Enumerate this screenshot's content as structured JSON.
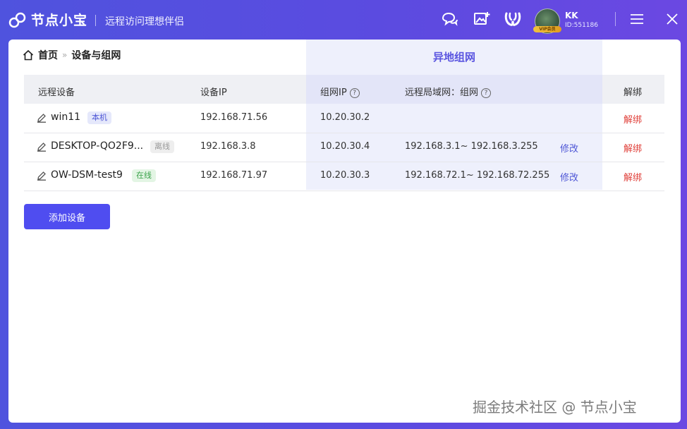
{
  "app": {
    "brand": "节点小宝",
    "slogan": "远程访问理想伴侣"
  },
  "user": {
    "name": "KK",
    "id": "ID:551186",
    "vip_label": "VIP会员"
  },
  "breadcrumb": {
    "home": "首页",
    "current": "设备与组网"
  },
  "group_header": "异地组网",
  "table": {
    "columns": [
      "远程设备",
      "设备IP",
      "组网IP",
      "远程局域网：组网",
      "解绑"
    ],
    "rows": [
      {
        "name": "win11",
        "badge": "本机",
        "badge_type": "local",
        "device_ip": "192.168.71.56",
        "group_ip": "10.20.30.2",
        "lan": "",
        "edit": "",
        "unbind": "解绑"
      },
      {
        "name": "DESKTOP-QO2F9...",
        "badge": "离线",
        "badge_type": "offline",
        "device_ip": "192.168.3.8",
        "group_ip": "10.20.30.4",
        "lan": "192.168.3.1~ 192.168.3.255",
        "edit": "修改",
        "unbind": "解绑"
      },
      {
        "name": "OW-DSM-test9",
        "badge": "在线",
        "badge_type": "online",
        "device_ip": "192.168.71.97",
        "group_ip": "10.20.30.3",
        "lan": "192.168.72.1~ 192.168.72.255",
        "edit": "修改",
        "unbind": "解绑"
      }
    ]
  },
  "add_device_label": "添加设备",
  "watermark": "掘金技术社区 @ 节点小宝"
}
